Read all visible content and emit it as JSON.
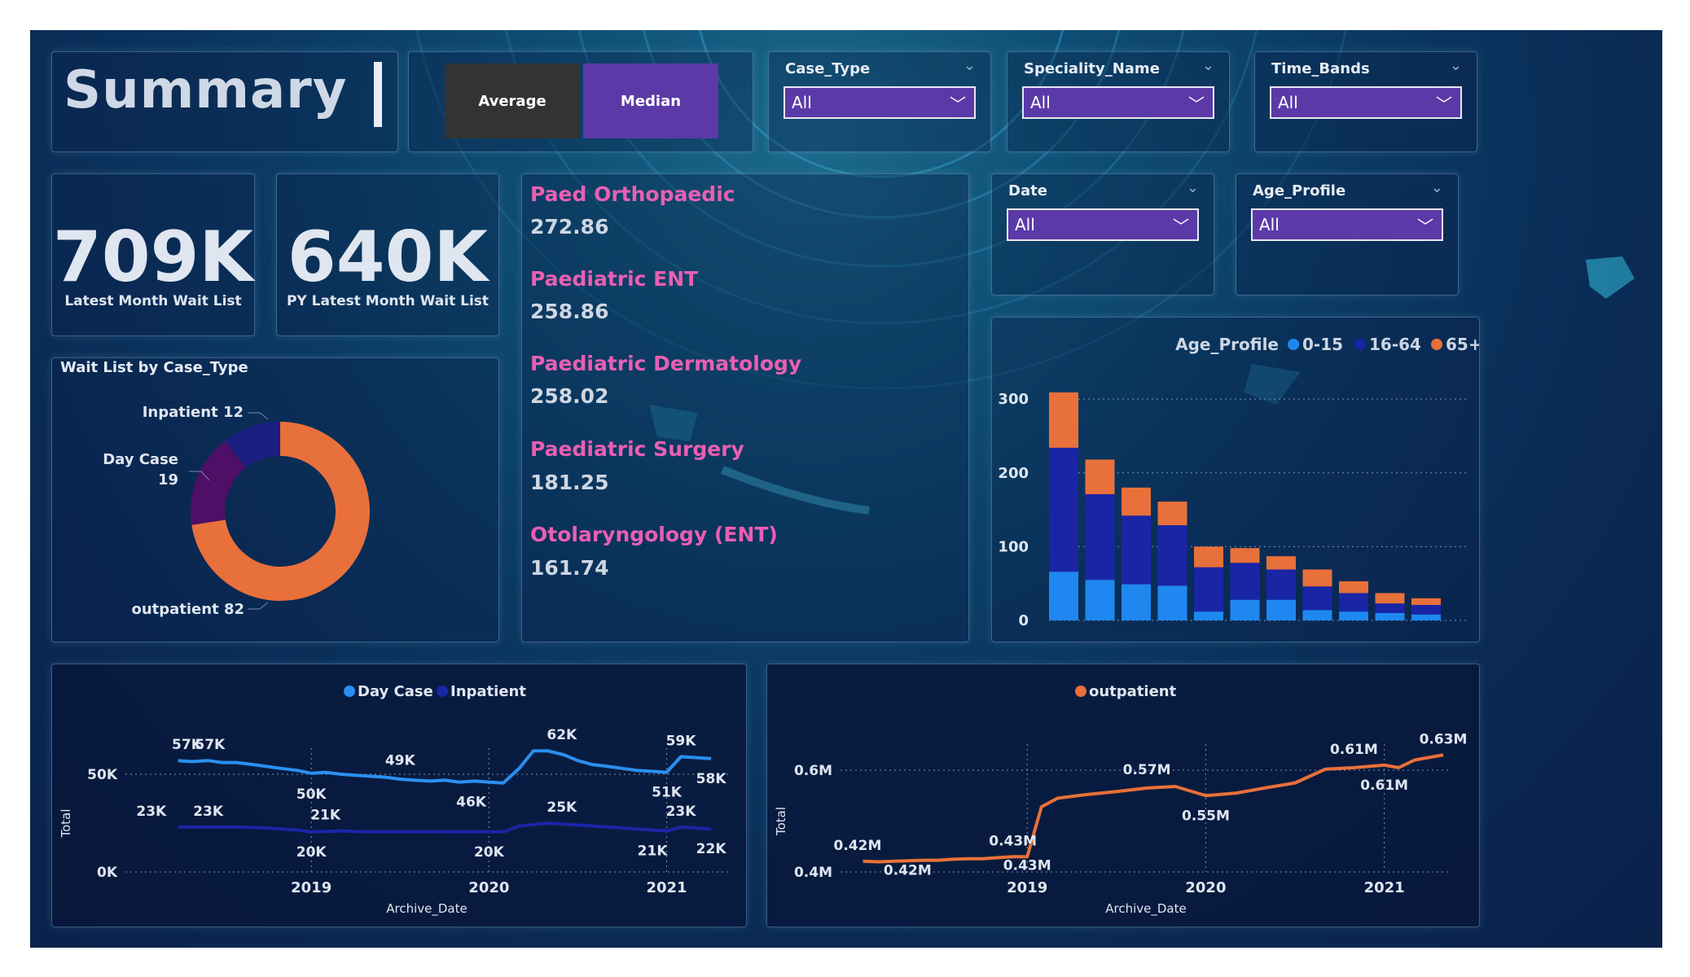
{
  "header": {
    "title": "Summary"
  },
  "toggle": {
    "average_label": "Average",
    "median_label": "Median"
  },
  "slicers": {
    "case_type": {
      "label": "Case_Type",
      "value": "All"
    },
    "speciality_name": {
      "label": "Speciality_Name",
      "value": "All"
    },
    "time_bands": {
      "label": "Time_Bands",
      "value": "All"
    },
    "date": {
      "label": "Date",
      "value": "All"
    },
    "age_profile": {
      "label": "Age_Profile",
      "value": "All"
    }
  },
  "kpis": [
    {
      "value": "709K",
      "label": "Latest Month Wait List"
    },
    {
      "value": "640K",
      "label": "PY Latest Month Wait List"
    }
  ],
  "specialities": [
    {
      "name": "Paed Orthopaedic",
      "value": "272.86"
    },
    {
      "name": "Paediatric ENT",
      "value": "258.86"
    },
    {
      "name": "Paediatric Dermatology",
      "value": "258.02"
    },
    {
      "name": "Paediatric Surgery",
      "value": "181.25"
    },
    {
      "name": "Otolaryngology (ENT)",
      "value": "161.74"
    }
  ],
  "colors": {
    "orange": "#e8703a",
    "dark_blue": "#1a25a6",
    "light_blue": "#1e88f0",
    "purple": "#4e0f66",
    "navy": "#18207a",
    "accent_purple": "#5b3aa8"
  },
  "chart_data": [
    {
      "type": "pie",
      "title": "Wait List by Case_Type",
      "slices": [
        {
          "label": "Inpatient",
          "value": 12,
          "color": "#1a1f80"
        },
        {
          "label": "Day Case",
          "value": 19,
          "color": "#4e0f66"
        },
        {
          "label": "outpatient",
          "value": 82,
          "color": "#e8703a"
        }
      ],
      "text": {
        "inpatient": "Inpatient 12",
        "daycase_name": "Day Case",
        "daycase_value": "19",
        "outpatient": "outpatient 82"
      }
    },
    {
      "type": "bar",
      "stacked": true,
      "legend_title": "Age_Profile",
      "series": [
        {
          "name": "0-15",
          "color": "#1e88f0",
          "values": [
            66,
            55,
            49,
            47,
            12,
            28,
            28,
            14,
            12,
            10,
            8
          ]
        },
        {
          "name": "16-64",
          "color": "#1a25a6",
          "values": [
            168,
            116,
            93,
            82,
            60,
            50,
            41,
            32,
            25,
            13,
            13
          ]
        },
        {
          "name": "65+",
          "color": "#e8703a",
          "values": [
            75,
            47,
            38,
            32,
            28,
            20,
            18,
            23,
            16,
            14,
            9
          ]
        }
      ],
      "yticks": [
        "0",
        "100",
        "200",
        "300"
      ],
      "ylim": [
        0,
        320
      ]
    },
    {
      "type": "line",
      "legend": [
        "Day Case",
        "Inpatient"
      ],
      "xlabel": "Archive_Date",
      "ylabel": "Total",
      "xticks": [
        "2019",
        "2020",
        "2021"
      ],
      "yticks": [
        "0K",
        "50K"
      ],
      "series": [
        {
          "name": "Day Case",
          "color": "#2a8ff0",
          "points": [
            [
              2018.25,
              57
            ],
            [
              2018.33,
              56.5
            ],
            [
              2018.42,
              57
            ],
            [
              2018.5,
              56
            ],
            [
              2018.58,
              56
            ],
            [
              2018.67,
              55
            ],
            [
              2018.75,
              54
            ],
            [
              2018.83,
              53
            ],
            [
              2018.92,
              52
            ],
            [
              2019.0,
              50.5
            ],
            [
              2019.08,
              51
            ],
            [
              2019.17,
              50
            ],
            [
              2019.25,
              49.5
            ],
            [
              2019.33,
              49
            ],
            [
              2019.42,
              48.5
            ],
            [
              2019.5,
              47.5
            ],
            [
              2019.58,
              47
            ],
            [
              2019.67,
              46.5
            ],
            [
              2019.75,
              47
            ],
            [
              2019.83,
              46
            ],
            [
              2019.92,
              46.5
            ],
            [
              2020.0,
              46
            ],
            [
              2020.08,
              45.5
            ],
            [
              2020.17,
              53
            ],
            [
              2020.25,
              62
            ],
            [
              2020.33,
              62
            ],
            [
              2020.42,
              60
            ],
            [
              2020.5,
              57
            ],
            [
              2020.58,
              55
            ],
            [
              2020.67,
              54
            ],
            [
              2020.75,
              53
            ],
            [
              2020.83,
              52
            ],
            [
              2020.92,
              51.5
            ],
            [
              2021.0,
              51
            ],
            [
              2021.08,
              59
            ],
            [
              2021.17,
              58.5
            ],
            [
              2021.25,
              58
            ]
          ]
        },
        {
          "name": "Inpatient",
          "color": "#1a25a6",
          "points": [
            [
              2018.25,
              23
            ],
            [
              2018.42,
              23
            ],
            [
              2018.58,
              23
            ],
            [
              2018.75,
              22.5
            ],
            [
              2018.92,
              21.5
            ],
            [
              2019.0,
              20.5
            ],
            [
              2019.17,
              21
            ],
            [
              2019.33,
              20.5
            ],
            [
              2019.5,
              20.5
            ],
            [
              2019.67,
              20.5
            ],
            [
              2019.83,
              20.5
            ],
            [
              2020.0,
              20.5
            ],
            [
              2020.08,
              20.5
            ],
            [
              2020.17,
              23.5
            ],
            [
              2020.33,
              25
            ],
            [
              2020.5,
              24
            ],
            [
              2020.67,
              23
            ],
            [
              2020.83,
              22
            ],
            [
              2021.0,
              21
            ],
            [
              2021.08,
              23
            ],
            [
              2021.17,
              22.5
            ],
            [
              2021.25,
              22
            ]
          ]
        }
      ],
      "labels": [
        {
          "t": "57K",
          "x": 2018.3,
          "y": 57,
          "pos": "above"
        },
        {
          "t": "57K",
          "x": 2018.43,
          "y": 57,
          "pos": "above"
        },
        {
          "t": "49K",
          "x": 2019.5,
          "y": 49,
          "pos": "above"
        },
        {
          "t": "50K",
          "x": 2019.0,
          "y": 50,
          "pos": "below"
        },
        {
          "t": "62K",
          "x": 2020.41,
          "y": 62,
          "pos": "above"
        },
        {
          "t": "46K",
          "x": 2019.9,
          "y": 46,
          "pos": "below"
        },
        {
          "t": "59K",
          "x": 2021.08,
          "y": 59,
          "pos": "above"
        },
        {
          "t": "58K",
          "x": 2021.25,
          "y": 58,
          "pos": "below"
        },
        {
          "t": "51K",
          "x": 2021.0,
          "y": 51,
          "pos": "below"
        },
        {
          "t": "23K",
          "x": 2018.1,
          "y": 23,
          "pos": "above"
        },
        {
          "t": "23K",
          "x": 2018.42,
          "y": 23,
          "pos": "above"
        },
        {
          "t": "21K",
          "x": 2019.08,
          "y": 21,
          "pos": "above"
        },
        {
          "t": "20K",
          "x": 2019.0,
          "y": 20.5,
          "pos": "below"
        },
        {
          "t": "20K",
          "x": 2020.0,
          "y": 20.5,
          "pos": "below"
        },
        {
          "t": "25K",
          "x": 2020.41,
          "y": 25,
          "pos": "above"
        },
        {
          "t": "23K",
          "x": 2021.08,
          "y": 23,
          "pos": "above"
        },
        {
          "t": "21K",
          "x": 2020.92,
          "y": 21,
          "pos": "below"
        },
        {
          "t": "22K",
          "x": 2021.25,
          "y": 22,
          "pos": "below"
        }
      ]
    },
    {
      "type": "line",
      "legend": [
        "outpatient"
      ],
      "xlabel": "Archive_Date",
      "ylabel": "Total",
      "xticks": [
        "2019",
        "2020",
        "2021"
      ],
      "yticks": [
        "0.4M",
        "0.6M"
      ],
      "series": [
        {
          "name": "outpatient",
          "color": "#e8703a",
          "points": [
            [
              2018.08,
              0.421
            ],
            [
              2018.17,
              0.42
            ],
            [
              2018.25,
              0.421
            ],
            [
              2018.33,
              0.422
            ],
            [
              2018.42,
              0.423
            ],
            [
              2018.5,
              0.423
            ],
            [
              2018.58,
              0.425
            ],
            [
              2018.67,
              0.426
            ],
            [
              2018.75,
              0.426
            ],
            [
              2018.83,
              0.428
            ],
            [
              2018.92,
              0.43
            ],
            [
              2019.0,
              0.43
            ],
            [
              2019.08,
              0.528
            ],
            [
              2019.17,
              0.545
            ],
            [
              2019.33,
              0.552
            ],
            [
              2019.5,
              0.558
            ],
            [
              2019.67,
              0.565
            ],
            [
              2019.83,
              0.568
            ],
            [
              2020.0,
              0.55
            ],
            [
              2020.17,
              0.555
            ],
            [
              2020.33,
              0.565
            ],
            [
              2020.5,
              0.575
            ],
            [
              2020.67,
              0.602
            ],
            [
              2020.83,
              0.605
            ],
            [
              2021.0,
              0.61
            ],
            [
              2021.08,
              0.605
            ],
            [
              2021.17,
              0.62
            ],
            [
              2021.33,
              0.63
            ]
          ]
        }
      ],
      "labels": [
        {
          "t": "0.42M",
          "x": 2018.05,
          "y": 0.421,
          "pos": "above"
        },
        {
          "t": "0.42M",
          "x": 2018.33,
          "y": 0.42,
          "pos": "below-tight"
        },
        {
          "t": "0.43M",
          "x": 2018.92,
          "y": 0.43,
          "pos": "above"
        },
        {
          "t": "0.43M",
          "x": 2019.0,
          "y": 0.43,
          "pos": "below-tight"
        },
        {
          "t": "0.57M",
          "x": 2019.67,
          "y": 0.57,
          "pos": "above"
        },
        {
          "t": "0.55M",
          "x": 2020.0,
          "y": 0.55,
          "pos": "below"
        },
        {
          "t": "0.61M",
          "x": 2020.83,
          "y": 0.61,
          "pos": "above"
        },
        {
          "t": "0.61M",
          "x": 2021.0,
          "y": 0.61,
          "pos": "below"
        },
        {
          "t": "0.63M",
          "x": 2021.33,
          "y": 0.63,
          "pos": "above"
        }
      ]
    }
  ]
}
